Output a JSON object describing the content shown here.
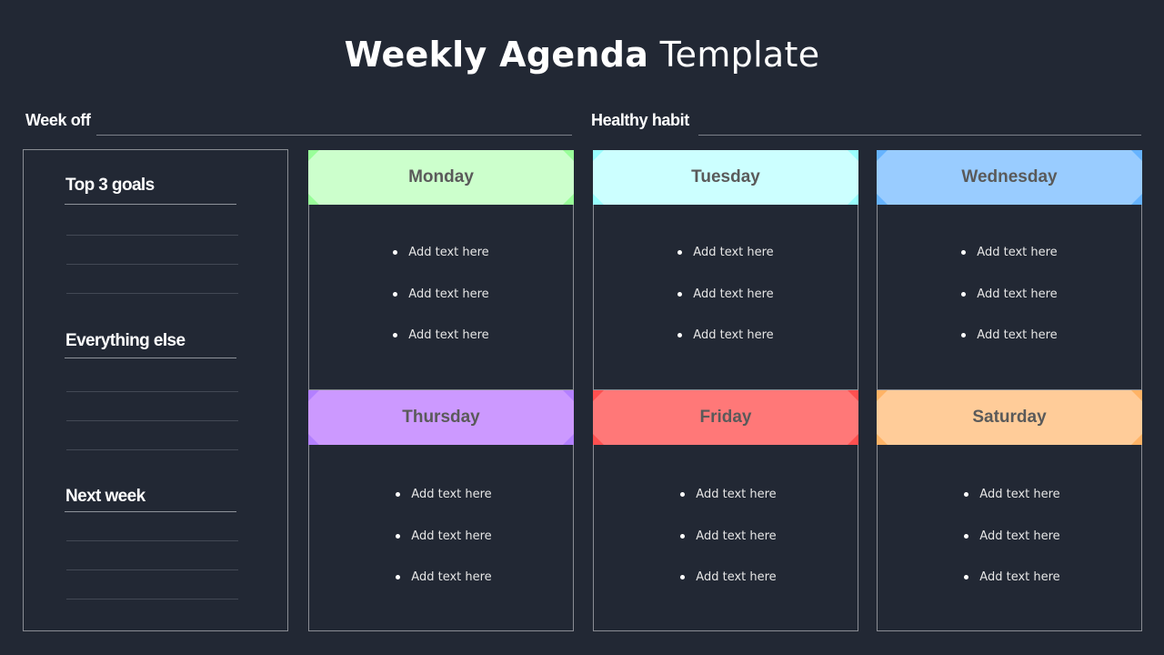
{
  "title": {
    "bold": "Weekly Agenda",
    "light": "Template"
  },
  "sections": {
    "week_off": "Week off",
    "healthy_habit": "Healthy habit"
  },
  "left_panel": {
    "groups": [
      {
        "heading": "Top 3 goals",
        "lines": 3
      },
      {
        "heading": "Everything else",
        "lines": 3
      },
      {
        "heading": "Next week",
        "lines": 3
      }
    ]
  },
  "days": [
    {
      "name": "Monday",
      "color": "#ccffcc",
      "accent": "#99ff99",
      "items": [
        "Add text here",
        "Add text here",
        "Add text here"
      ]
    },
    {
      "name": "Tuesday",
      "color": "#ccffff",
      "accent": "#99ffff",
      "items": [
        "Add text here",
        "Add text here",
        "Add text here"
      ]
    },
    {
      "name": "Wednesday",
      "color": "#99ccff",
      "accent": "#66b3ff",
      "items": [
        "Add text here",
        "Add text here",
        "Add text here"
      ]
    },
    {
      "name": "Thursday",
      "color": "#cc99ff",
      "accent": "#b380ff",
      "items": [
        "Add text here",
        "Add text here",
        "Add text here"
      ]
    },
    {
      "name": "Friday",
      "color": "#ff7878",
      "accent": "#ff5050",
      "items": [
        "Add text here",
        "Add text here",
        "Add text here"
      ]
    },
    {
      "name": "Saturday",
      "color": "#ffcc99",
      "accent": "#ffb366",
      "items": [
        "Add text here",
        "Add text here",
        "Add text here"
      ]
    }
  ]
}
